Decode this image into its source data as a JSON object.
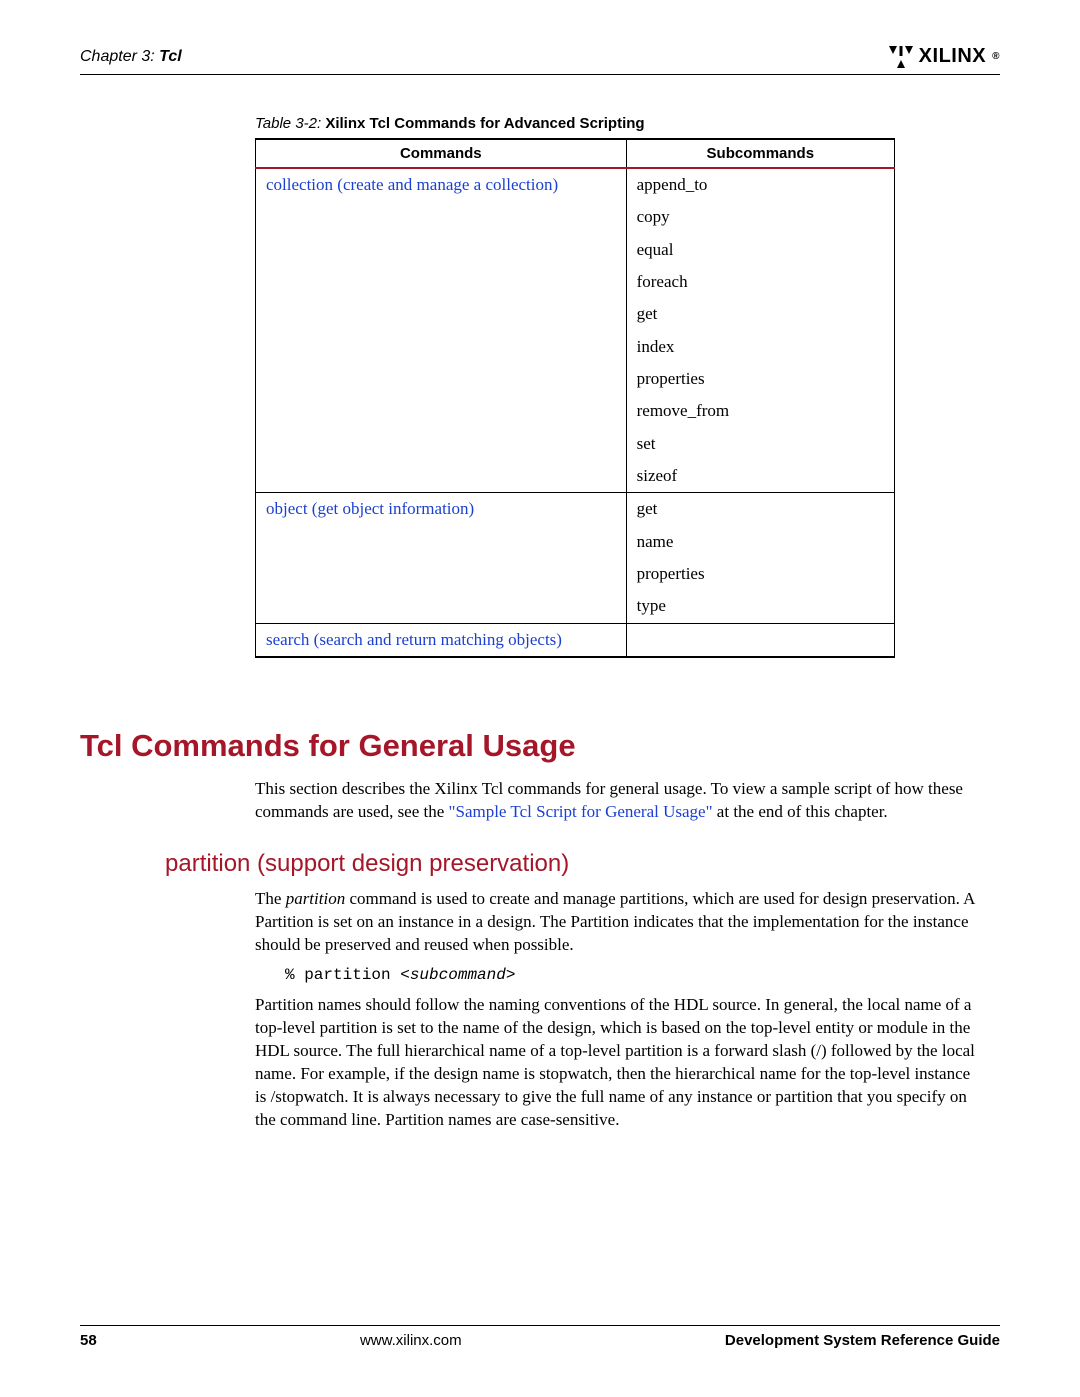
{
  "header": {
    "chapter_prefix": "Chapter 3:",
    "chapter_title": "Tcl",
    "logo_text": "XILINX",
    "logo_reg": "®"
  },
  "table": {
    "caption_prefix": "Table 3-2:",
    "caption_title": "Xilinx Tcl Commands for Advanced Scripting",
    "header_commands": "Commands",
    "header_sub": "Subcommands",
    "rows": {
      "collection_cmd": "collection (create and manage a collection)",
      "sub_append": "append_to",
      "sub_copy": "copy",
      "sub_equal": "equal",
      "sub_foreach": "foreach",
      "sub_get": "get",
      "sub_index": "index",
      "sub_properties": "properties",
      "sub_removefrom": "remove_from",
      "sub_set": "set",
      "sub_sizeof": "sizeof",
      "object_cmd": "object (get object information)",
      "obj_get": "get",
      "obj_name": "name",
      "obj_properties": "properties",
      "obj_type": "type",
      "search_cmd": "search (search and return matching objects)"
    }
  },
  "section": {
    "h1": "Tcl Commands for General Usage",
    "intro_pre": "This section describes the Xilinx Tcl commands for general usage. To view a sample script of how these commands are used, see the ",
    "intro_link": "\"Sample Tcl Script for General Usage\"",
    "intro_post": " at the end of this chapter.",
    "h2": "partition (support design preservation)",
    "p1_pre": "The ",
    "p1_ital": "partition",
    "p1_post": " command is used to create and manage partitions, which are used for design preservation. A Partition is set on an instance in a design. The Partition indicates that the implementation for the instance should be preserved and reused when possible.",
    "code_prefix": "% partition <",
    "code_ital": "subcommand",
    "code_suffix": ">",
    "p2": "Partition names should follow the naming conventions of the HDL source. In general, the local name of a top-level partition is set to the name of the design, which is based on the top-level entity or module in the HDL source. The full hierarchical name of a top-level partition is a forward slash (/) followed by the local name. For example, if the design name is stopwatch, then the hierarchical name for the top-level instance is /stopwatch. It is always necessary to give the full name of any instance or partition that you specify on the command line. Partition names are case-sensitive."
  },
  "footer": {
    "page": "58",
    "url": "www.xilinx.com",
    "doc": "Development System Reference Guide"
  }
}
